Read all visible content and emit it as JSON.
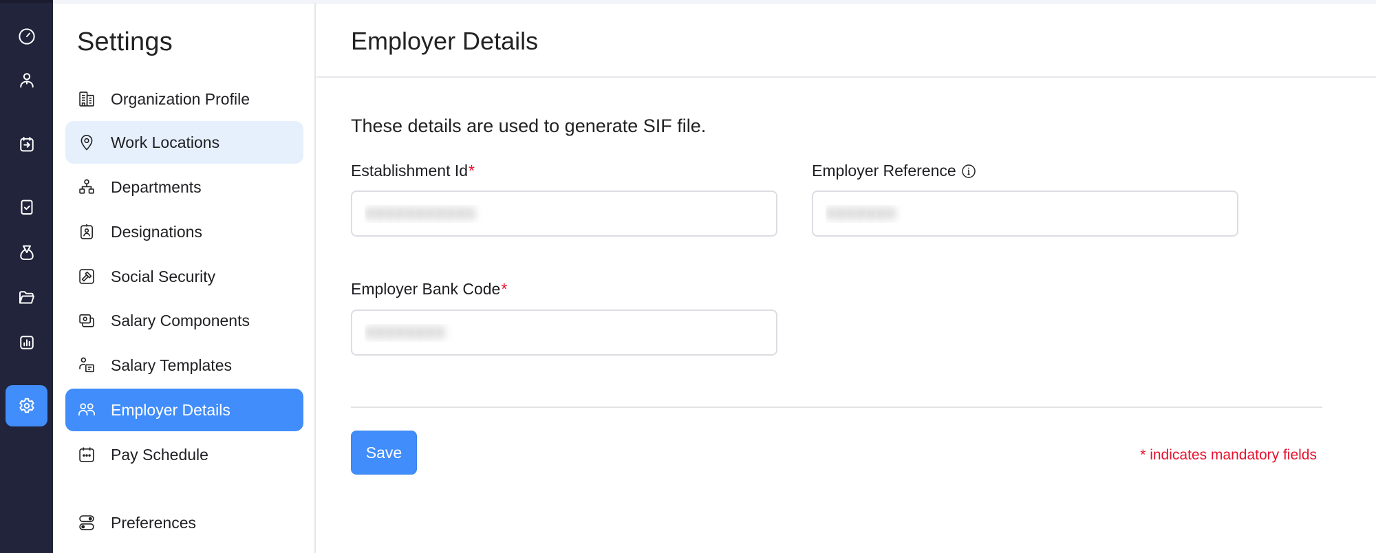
{
  "rail": {
    "items": [
      {
        "name": "dashboard",
        "icon": "gauge-icon",
        "active": false
      },
      {
        "name": "employees",
        "icon": "user-icon",
        "active": false
      },
      {
        "name": "pay-runs",
        "icon": "calendar-arrow-icon",
        "active": false
      },
      {
        "name": "approvals",
        "icon": "clipboard-check-icon",
        "active": false
      },
      {
        "name": "loans",
        "icon": "money-bag-icon",
        "active": false
      },
      {
        "name": "documents",
        "icon": "folder-open-icon",
        "active": false
      },
      {
        "name": "reports",
        "icon": "bar-chart-icon",
        "active": false
      },
      {
        "name": "settings",
        "icon": "gear-icon",
        "active": true
      }
    ]
  },
  "settings": {
    "title": "Settings",
    "items": [
      {
        "label": "Organization Profile",
        "icon": "building-icon",
        "state": "normal"
      },
      {
        "label": "Work Locations",
        "icon": "map-pin-icon",
        "state": "hover"
      },
      {
        "label": "Departments",
        "icon": "org-chart-icon",
        "state": "normal"
      },
      {
        "label": "Designations",
        "icon": "id-badge-icon",
        "state": "normal"
      },
      {
        "label": "Social Security",
        "icon": "gavel-icon",
        "state": "normal"
      },
      {
        "label": "Salary Components",
        "icon": "cash-icon",
        "state": "normal"
      },
      {
        "label": "Salary Templates",
        "icon": "user-template-icon",
        "state": "normal"
      },
      {
        "label": "Employer Details",
        "icon": "users-icon",
        "state": "active"
      },
      {
        "label": "Pay Schedule",
        "icon": "calendar-dots-icon",
        "state": "normal"
      },
      {
        "label": "Preferences",
        "icon": "toggles-icon",
        "state": "normal"
      }
    ]
  },
  "main": {
    "title": "Employer Details",
    "subtitle": "These details are used to generate SIF file.",
    "fields": {
      "establishment_id": {
        "label": "Establishment Id",
        "required_mark": "*",
        "value": "XXXXXXXXXXX"
      },
      "employer_reference": {
        "label": "Employer Reference",
        "info_icon": "info-icon",
        "value": "XXXXXXX"
      },
      "employer_bank_code": {
        "label": "Employer Bank Code",
        "required_mark": "*",
        "value": "XXXXXXXX"
      }
    },
    "save_label": "Save",
    "mandatory_note": "* indicates mandatory fields"
  },
  "colors": {
    "rail_bg": "#21243a",
    "accent": "#408dfb",
    "hover_bg": "#e6f0fd",
    "required": "#e8112d"
  }
}
